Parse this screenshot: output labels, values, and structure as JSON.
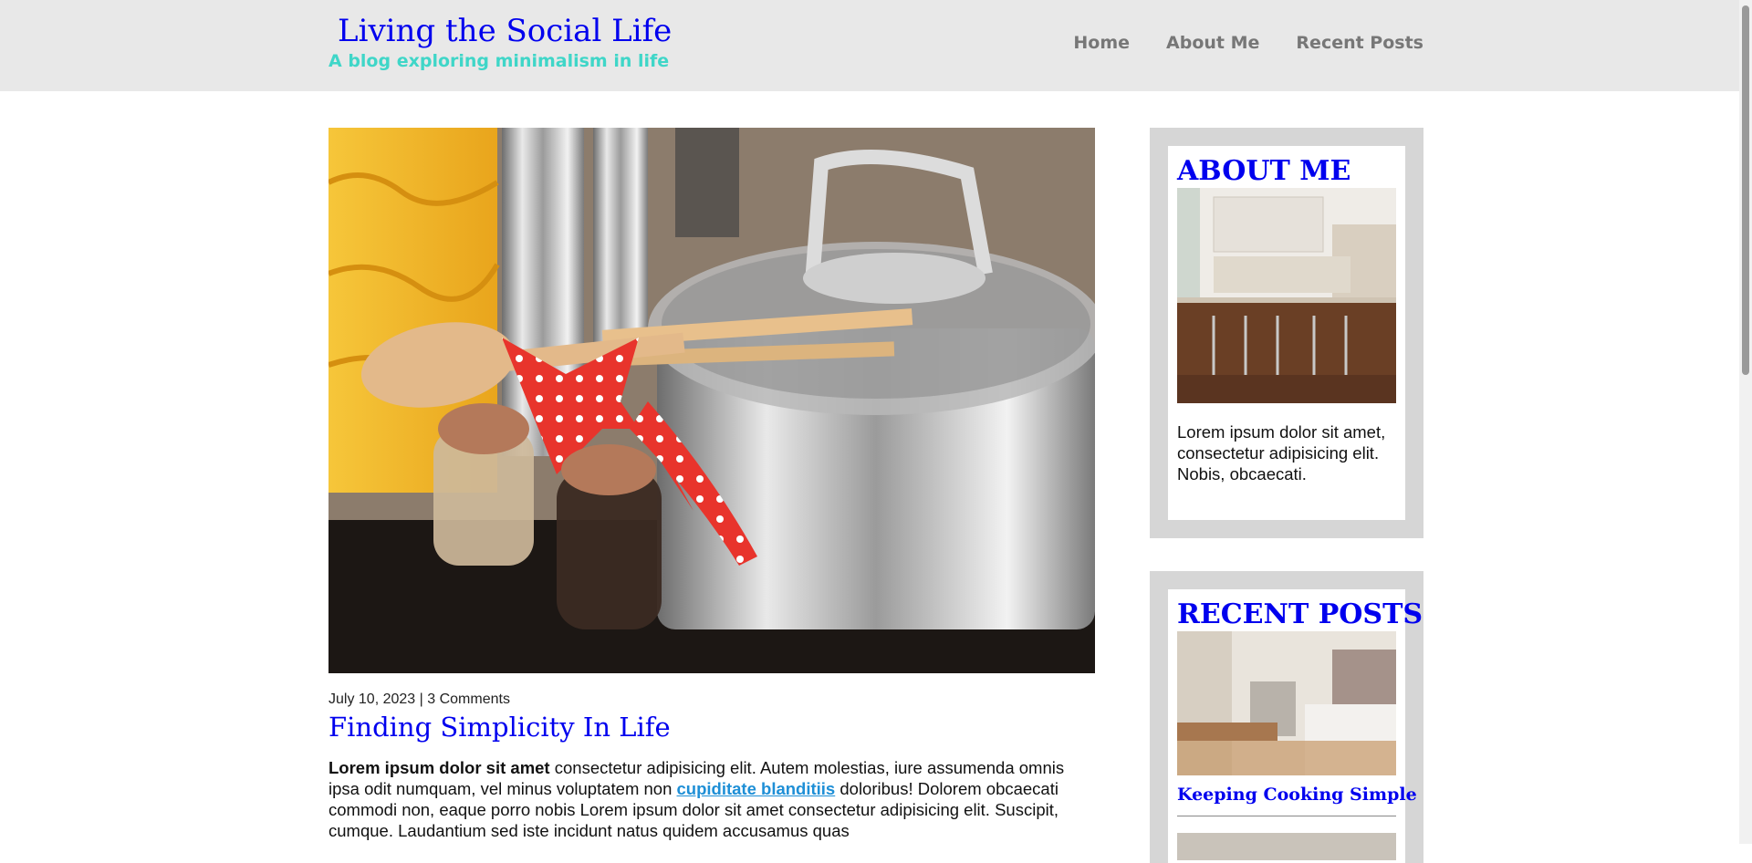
{
  "header": {
    "title": "Living the Social Life",
    "subtitle": "A blog exploring minimalism in life",
    "nav": [
      "Home",
      "About Me",
      "Recent Posts"
    ]
  },
  "post": {
    "date": "July 10, 2023",
    "separator": "|",
    "comments": "3 Comments",
    "title": "Finding Simplicity In Life",
    "body": {
      "lead": "Lorem ipsum dolor sit amet",
      "text1": " consectetur adipisicing elit. Autem molestias, iure assumenda omnis ipsa odit numquam, vel minus voluptatem non ",
      "link": "cupiditate blanditiis",
      "text2": " doloribus! Dolorem obcaecati commodi non, eaque porro nobis Lorem ipsum dolor sit amet consectetur adipisicing elit. Suscipit, cumque. Laudantium sed iste incidunt natus quidem accusamus quas"
    }
  },
  "sidebar": {
    "about": {
      "heading": "ABOUT ME",
      "text": "Lorem ipsum dolor sit amet, consectetur adipisicing elit. Nobis, obcaecati."
    },
    "recent": {
      "heading": "RECENT POSTS",
      "items": [
        {
          "title": "Keeping Cooking Simple"
        }
      ]
    }
  },
  "colors": {
    "title_blue": "#0000ee",
    "subtitle_teal": "#3fd6c8",
    "link_blue": "#1e8fd6",
    "header_bg": "#e8e8e8",
    "widget_bg": "#d6d6d6"
  }
}
